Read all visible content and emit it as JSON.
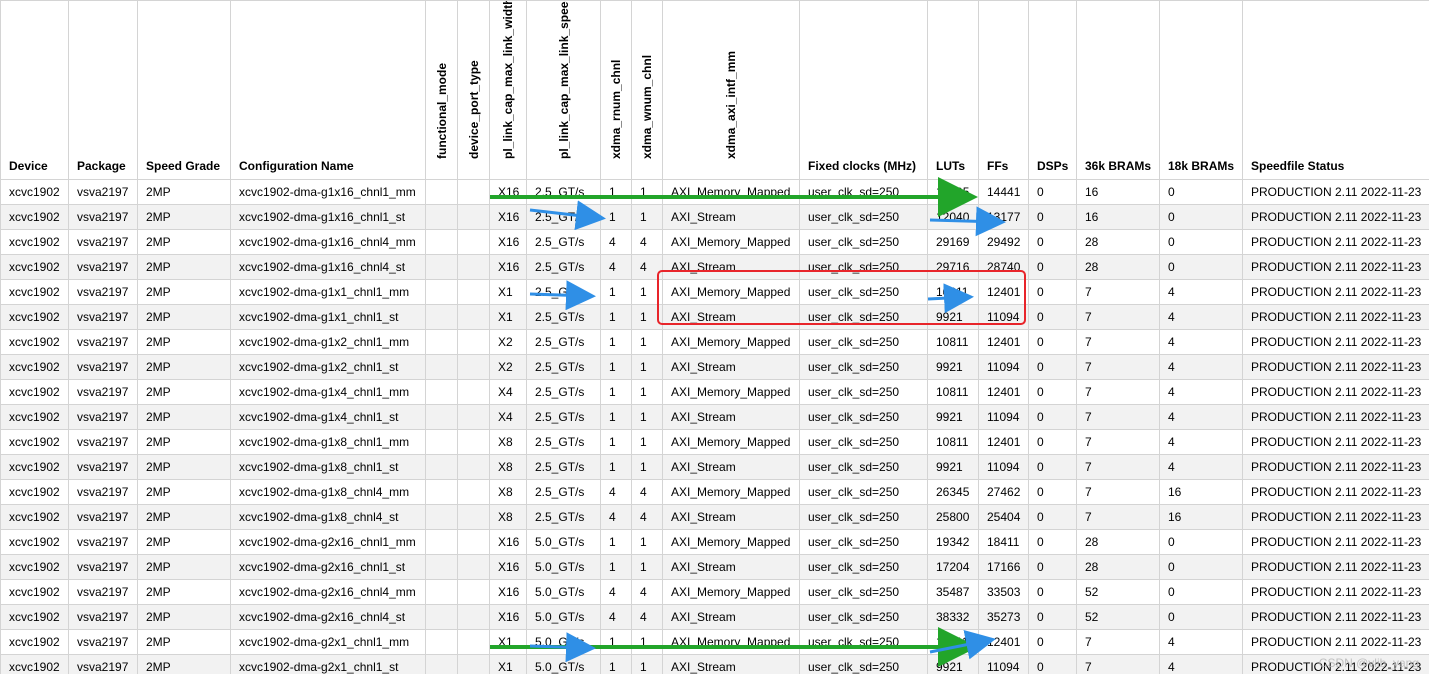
{
  "columns": [
    {
      "key": "device",
      "label": "Device",
      "rotated": false
    },
    {
      "key": "package",
      "label": "Package",
      "rotated": false
    },
    {
      "key": "speed_grade",
      "label": "Speed Grade",
      "rotated": false
    },
    {
      "key": "config_name",
      "label": "Configuration Name",
      "rotated": false
    },
    {
      "key": "functional_mode",
      "label": "functional_mode",
      "rotated": true
    },
    {
      "key": "device_port_type",
      "label": "device_port_type",
      "rotated": true
    },
    {
      "key": "link_width",
      "label": "pl_link_cap_max_link_width",
      "rotated": true
    },
    {
      "key": "link_speed",
      "label": "pl_link_cap_max_link_speed",
      "rotated": true
    },
    {
      "key": "rnum_chnl",
      "label": "xdma_rnum_chnl",
      "rotated": true
    },
    {
      "key": "wnum_chnl",
      "label": "xdma_wnum_chnl",
      "rotated": true
    },
    {
      "key": "axi_intf",
      "label": "xdma_axi_intf_mm",
      "rotated": true
    },
    {
      "key": "fixed_clocks",
      "label": "Fixed clocks (MHz)",
      "rotated": false
    },
    {
      "key": "luts",
      "label": "LUTs",
      "rotated": false
    },
    {
      "key": "ffs",
      "label": "FFs",
      "rotated": false
    },
    {
      "key": "dsps",
      "label": "DSPs",
      "rotated": false
    },
    {
      "key": "bram36",
      "label": "36k BRAMs",
      "rotated": false
    },
    {
      "key": "bram18",
      "label": "18k BRAMs",
      "rotated": false
    },
    {
      "key": "status",
      "label": "Speedfile Status",
      "rotated": false
    }
  ],
  "rows": [
    [
      "xcvc1902",
      "vsva2197",
      "2MP",
      "xcvc1902-dma-g1x16_chnl1_mm",
      "",
      "",
      "X16",
      "2.5_GT/s",
      "1",
      "1",
      "AXI_Memory_Mapped",
      "user_clk_sd=250",
      "13195",
      "14441",
      "0",
      "16",
      "0",
      "PRODUCTION 2.11 2022-11-23"
    ],
    [
      "xcvc1902",
      "vsva2197",
      "2MP",
      "xcvc1902-dma-g1x16_chnl1_st",
      "",
      "",
      "X16",
      "2.5_GT/s",
      "1",
      "1",
      "AXI_Stream",
      "user_clk_sd=250",
      "12040",
      "13177",
      "0",
      "16",
      "0",
      "PRODUCTION 2.11 2022-11-23"
    ],
    [
      "xcvc1902",
      "vsva2197",
      "2MP",
      "xcvc1902-dma-g1x16_chnl4_mm",
      "",
      "",
      "X16",
      "2.5_GT/s",
      "4",
      "4",
      "AXI_Memory_Mapped",
      "user_clk_sd=250",
      "29169",
      "29492",
      "0",
      "28",
      "0",
      "PRODUCTION 2.11 2022-11-23"
    ],
    [
      "xcvc1902",
      "vsva2197",
      "2MP",
      "xcvc1902-dma-g1x16_chnl4_st",
      "",
      "",
      "X16",
      "2.5_GT/s",
      "4",
      "4",
      "AXI_Stream",
      "user_clk_sd=250",
      "29716",
      "28740",
      "0",
      "28",
      "0",
      "PRODUCTION 2.11 2022-11-23"
    ],
    [
      "xcvc1902",
      "vsva2197",
      "2MP",
      "xcvc1902-dma-g1x1_chnl1_mm",
      "",
      "",
      "X1",
      "2.5_GT/s",
      "1",
      "1",
      "AXI_Memory_Mapped",
      "user_clk_sd=250",
      "10811",
      "12401",
      "0",
      "7",
      "4",
      "PRODUCTION 2.11 2022-11-23"
    ],
    [
      "xcvc1902",
      "vsva2197",
      "2MP",
      "xcvc1902-dma-g1x1_chnl1_st",
      "",
      "",
      "X1",
      "2.5_GT/s",
      "1",
      "1",
      "AXI_Stream",
      "user_clk_sd=250",
      "9921",
      "11094",
      "0",
      "7",
      "4",
      "PRODUCTION 2.11 2022-11-23"
    ],
    [
      "xcvc1902",
      "vsva2197",
      "2MP",
      "xcvc1902-dma-g1x2_chnl1_mm",
      "",
      "",
      "X2",
      "2.5_GT/s",
      "1",
      "1",
      "AXI_Memory_Mapped",
      "user_clk_sd=250",
      "10811",
      "12401",
      "0",
      "7",
      "4",
      "PRODUCTION 2.11 2022-11-23"
    ],
    [
      "xcvc1902",
      "vsva2197",
      "2MP",
      "xcvc1902-dma-g1x2_chnl1_st",
      "",
      "",
      "X2",
      "2.5_GT/s",
      "1",
      "1",
      "AXI_Stream",
      "user_clk_sd=250",
      "9921",
      "11094",
      "0",
      "7",
      "4",
      "PRODUCTION 2.11 2022-11-23"
    ],
    [
      "xcvc1902",
      "vsva2197",
      "2MP",
      "xcvc1902-dma-g1x4_chnl1_mm",
      "",
      "",
      "X4",
      "2.5_GT/s",
      "1",
      "1",
      "AXI_Memory_Mapped",
      "user_clk_sd=250",
      "10811",
      "12401",
      "0",
      "7",
      "4",
      "PRODUCTION 2.11 2022-11-23"
    ],
    [
      "xcvc1902",
      "vsva2197",
      "2MP",
      "xcvc1902-dma-g1x4_chnl1_st",
      "",
      "",
      "X4",
      "2.5_GT/s",
      "1",
      "1",
      "AXI_Stream",
      "user_clk_sd=250",
      "9921",
      "11094",
      "0",
      "7",
      "4",
      "PRODUCTION 2.11 2022-11-23"
    ],
    [
      "xcvc1902",
      "vsva2197",
      "2MP",
      "xcvc1902-dma-g1x8_chnl1_mm",
      "",
      "",
      "X8",
      "2.5_GT/s",
      "1",
      "1",
      "AXI_Memory_Mapped",
      "user_clk_sd=250",
      "10811",
      "12401",
      "0",
      "7",
      "4",
      "PRODUCTION 2.11 2022-11-23"
    ],
    [
      "xcvc1902",
      "vsva2197",
      "2MP",
      "xcvc1902-dma-g1x8_chnl1_st",
      "",
      "",
      "X8",
      "2.5_GT/s",
      "1",
      "1",
      "AXI_Stream",
      "user_clk_sd=250",
      "9921",
      "11094",
      "0",
      "7",
      "4",
      "PRODUCTION 2.11 2022-11-23"
    ],
    [
      "xcvc1902",
      "vsva2197",
      "2MP",
      "xcvc1902-dma-g1x8_chnl4_mm",
      "",
      "",
      "X8",
      "2.5_GT/s",
      "4",
      "4",
      "AXI_Memory_Mapped",
      "user_clk_sd=250",
      "26345",
      "27462",
      "0",
      "7",
      "16",
      "PRODUCTION 2.11 2022-11-23"
    ],
    [
      "xcvc1902",
      "vsva2197",
      "2MP",
      "xcvc1902-dma-g1x8_chnl4_st",
      "",
      "",
      "X8",
      "2.5_GT/s",
      "4",
      "4",
      "AXI_Stream",
      "user_clk_sd=250",
      "25800",
      "25404",
      "0",
      "7",
      "16",
      "PRODUCTION 2.11 2022-11-23"
    ],
    [
      "xcvc1902",
      "vsva2197",
      "2MP",
      "xcvc1902-dma-g2x16_chnl1_mm",
      "",
      "",
      "X16",
      "5.0_GT/s",
      "1",
      "1",
      "AXI_Memory_Mapped",
      "user_clk_sd=250",
      "19342",
      "18411",
      "0",
      "28",
      "0",
      "PRODUCTION 2.11 2022-11-23"
    ],
    [
      "xcvc1902",
      "vsva2197",
      "2MP",
      "xcvc1902-dma-g2x16_chnl1_st",
      "",
      "",
      "X16",
      "5.0_GT/s",
      "1",
      "1",
      "AXI_Stream",
      "user_clk_sd=250",
      "17204",
      "17166",
      "0",
      "28",
      "0",
      "PRODUCTION 2.11 2022-11-23"
    ],
    [
      "xcvc1902",
      "vsva2197",
      "2MP",
      "xcvc1902-dma-g2x16_chnl4_mm",
      "",
      "",
      "X16",
      "5.0_GT/s",
      "4",
      "4",
      "AXI_Memory_Mapped",
      "user_clk_sd=250",
      "35487",
      "33503",
      "0",
      "52",
      "0",
      "PRODUCTION 2.11 2022-11-23"
    ],
    [
      "xcvc1902",
      "vsva2197",
      "2MP",
      "xcvc1902-dma-g2x16_chnl4_st",
      "",
      "",
      "X16",
      "5.0_GT/s",
      "4",
      "4",
      "AXI_Stream",
      "user_clk_sd=250",
      "38332",
      "35273",
      "0",
      "52",
      "0",
      "PRODUCTION 2.11 2022-11-23"
    ],
    [
      "xcvc1902",
      "vsva2197",
      "2MP",
      "xcvc1902-dma-g2x1_chnl1_mm",
      "",
      "",
      "X1",
      "5.0_GT/s",
      "1",
      "1",
      "AXI_Memory_Mapped",
      "user_clk_sd=250",
      "10811",
      "12401",
      "0",
      "7",
      "4",
      "PRODUCTION 2.11 2022-11-23"
    ],
    [
      "xcvc1902",
      "vsva2197",
      "2MP",
      "xcvc1902-dma-g2x1_chnl1_st",
      "",
      "",
      "X1",
      "5.0_GT/s",
      "1",
      "1",
      "AXI_Stream",
      "user_clk_sd=250",
      "9921",
      "11094",
      "0",
      "7",
      "4",
      "PRODUCTION 2.11 2022-11-23"
    ]
  ],
  "annotations": {
    "arrow_colors": {
      "green": "#22a52a",
      "blue": "#2f8fe6"
    },
    "highlight_color": "#e8242a"
  },
  "watermark": "CSDN @vlib_yang"
}
